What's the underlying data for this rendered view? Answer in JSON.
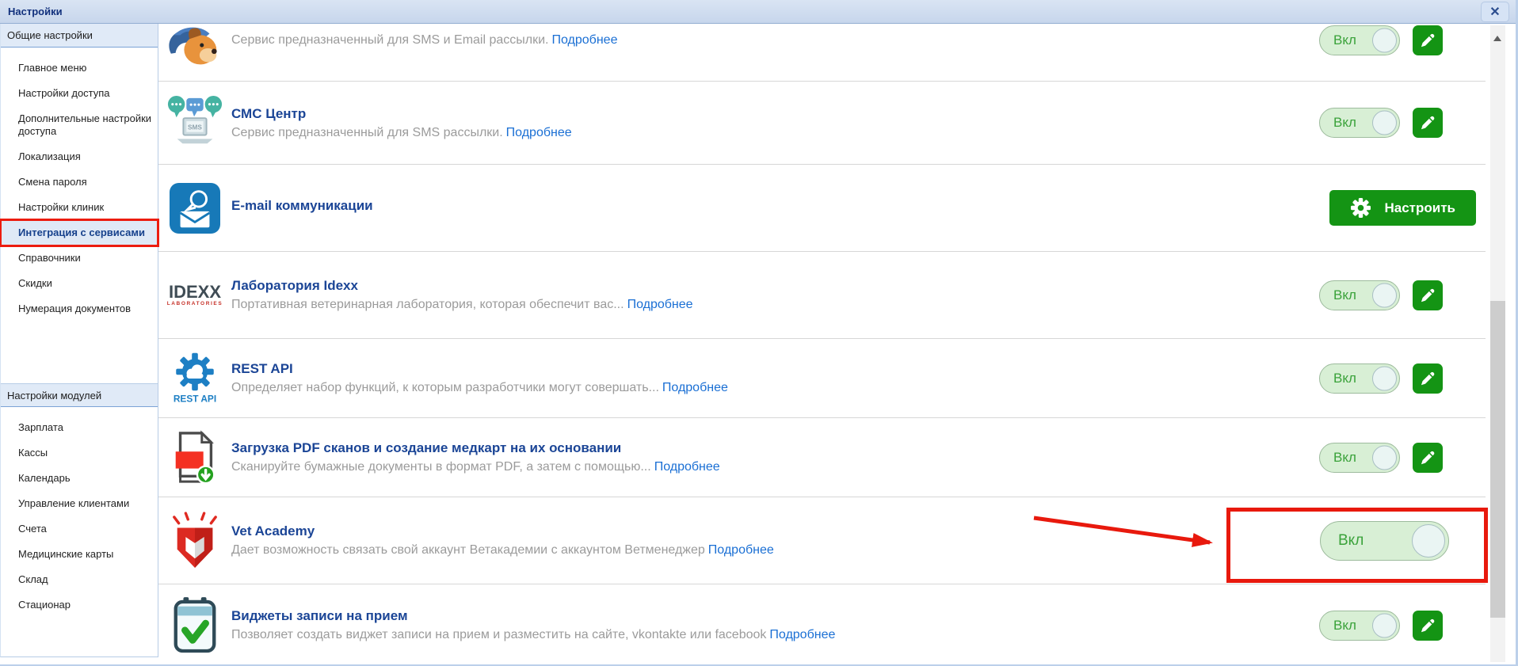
{
  "window": {
    "title": "Настройки",
    "close_icon": "✕"
  },
  "colors": {
    "titlebar_bg": "#cfdded",
    "accent_green": "#149414",
    "toggle_bg": "#d8efd5",
    "toggle_text": "#3aa23a",
    "title_blue": "#1b4596",
    "link_blue": "#1a6fd4",
    "desc_gray": "#9b9b9b",
    "annotation_red": "#e8190d"
  },
  "sidebar": {
    "sections": [
      {
        "header": "Общие настройки",
        "items": [
          {
            "id": "main-menu",
            "label": "Главное меню"
          },
          {
            "id": "access-settings",
            "label": "Настройки доступа"
          },
          {
            "id": "additional-access-settings",
            "label": "Дополнительные настройки доступа"
          },
          {
            "id": "localization",
            "label": "Локализация"
          },
          {
            "id": "change-password",
            "label": "Смена пароля"
          },
          {
            "id": "clinic-settings",
            "label": "Настройки клиник"
          },
          {
            "id": "service-integration",
            "label": "Интеграция с сервисами",
            "selected": true,
            "annotated": true
          },
          {
            "id": "directories",
            "label": "Справочники"
          },
          {
            "id": "discounts",
            "label": "Скидки"
          },
          {
            "id": "document-numbering",
            "label": "Нумерация документов"
          }
        ]
      },
      {
        "header": "Настройки модулей",
        "items": [
          {
            "id": "salary",
            "label": "Зарплата"
          },
          {
            "id": "cash-registers",
            "label": "Кассы"
          },
          {
            "id": "calendar",
            "label": "Календарь"
          },
          {
            "id": "client-management",
            "label": "Управление клиентами"
          },
          {
            "id": "invoices",
            "label": "Счета"
          },
          {
            "id": "medical-records",
            "label": "Медицинские карты"
          },
          {
            "id": "warehouse",
            "label": "Склад"
          },
          {
            "id": "inpatient",
            "label": "Стационар"
          }
        ]
      }
    ]
  },
  "services": [
    {
      "name": "sms-email-service",
      "icon": "dog-mascot-icon",
      "title": "",
      "description": "Сервис предназначенный для SMS и Email рассылки.",
      "link_label": "Подробнее",
      "control": "toggle",
      "toggle_label": "Вкл",
      "has_edit": true
    },
    {
      "name": "sms-center",
      "icon": "sms-center-icon",
      "icon_text": "SMS",
      "title": "СМС Центр",
      "description": "Сервис предназначенный для SMS рассылки.",
      "link_label": "Подробнее",
      "control": "toggle",
      "toggle_label": "Вкл",
      "has_edit": true
    },
    {
      "name": "email-communications",
      "icon": "email-chat-icon",
      "title": "E-mail коммуникации",
      "description": "",
      "control": "button",
      "button_label": "Настроить"
    },
    {
      "name": "idexx-laboratory",
      "icon": "idexx-logo",
      "logo_line1": "IDEXX",
      "logo_line2": "LABORATORIES",
      "title": "Лаборатория Idexx",
      "description": "Портативная ветеринарная лаборатория, которая обеспечит вас...",
      "link_label": "Подробнее",
      "control": "toggle",
      "toggle_label": "Вкл",
      "has_edit": true
    },
    {
      "name": "rest-api",
      "icon": "rest-api-icon",
      "icon_caption": "REST API",
      "title": "REST API",
      "description": "Определяет набор функций, к которым разработчики могут совершать...",
      "link_label": "Подробнее",
      "control": "toggle",
      "toggle_label": "Вкл",
      "has_edit": true
    },
    {
      "name": "pdf-upload",
      "icon": "pdf-upload-icon",
      "title": "Загрузка PDF сканов и создание медкарт на их основании",
      "description": "Сканируйте бумажные документы в формат PDF, а затем с помощью...",
      "link_label": "Подробнее",
      "control": "toggle",
      "toggle_label": "Вкл",
      "has_edit": true
    },
    {
      "name": "vet-academy",
      "icon": "vet-academy-icon",
      "title": "Vet Academy",
      "description": "Дает возможность связать свой аккаунт Ветакадемии с аккаунтом Ветменеджер",
      "link_label": "Подробнее",
      "control": "toggle-large",
      "toggle_label": "Вкл",
      "has_edit": false,
      "annotated": true
    },
    {
      "name": "appointment-widgets",
      "icon": "appointment-widget-icon",
      "title": "Виджеты записи на прием",
      "description": "Позволяет создать виджет записи на прием и разместить на сайте, vkontakte или facebook",
      "link_label": "Подробнее",
      "control": "toggle",
      "toggle_label": "Вкл",
      "has_edit": true
    }
  ]
}
